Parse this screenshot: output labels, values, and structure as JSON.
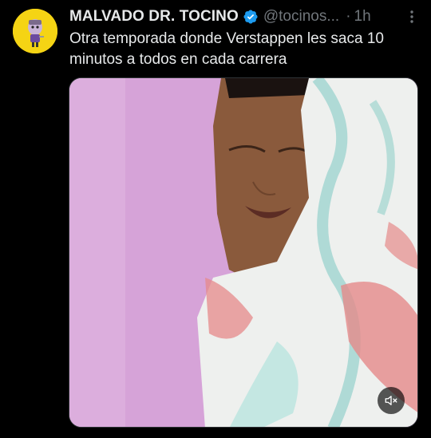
{
  "tweet": {
    "author_name": "MALVADO DR. TOCINO",
    "handle": "@tocinos...",
    "separator": "·",
    "time": "1h",
    "text": "Otra temporada donde Verstappen les saca 10 minutos a todos en cada carrera"
  },
  "icons": {
    "verified": "verified-badge-icon",
    "more": "more-options-icon",
    "mute": "volume-muted-icon"
  },
  "colors": {
    "background": "#000000",
    "text_primary": "#e7e9ea",
    "text_secondary": "#71767b",
    "verified": "#1d9bf0",
    "avatar_bg": "#f5d414"
  }
}
